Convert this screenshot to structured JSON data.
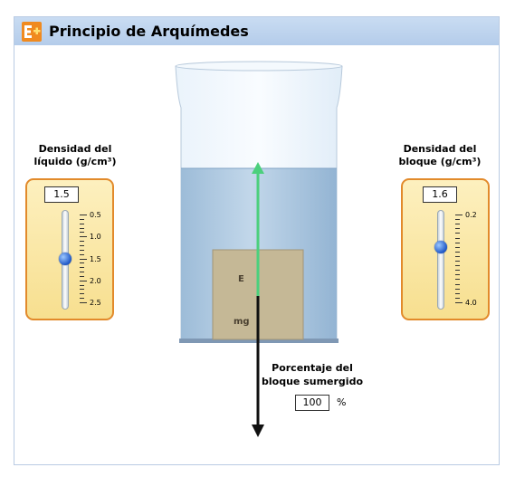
{
  "app": {
    "title": "Principio de Arquímedes",
    "logo": "arrow-plus-logo-icon"
  },
  "liquid_panel": {
    "title_line1": "Densidad del",
    "title_line2": "líquido (g/cm³)",
    "value": "1.5",
    "scale_labels": [
      "0.5",
      "1.0",
      "1.5",
      "2.0",
      "2.5"
    ],
    "min": 0.5,
    "max": 2.5,
    "current": 1.5
  },
  "block_panel": {
    "title_line1": "Densidad del",
    "title_line2": "bloque (g/cm³)",
    "value": "1.6",
    "scale_labels": [
      "0.2",
      "4.0"
    ],
    "min": 0.2,
    "max": 4.0,
    "current": 1.6
  },
  "beaker": {
    "force_buoyancy": "E",
    "force_weight": "mg",
    "colors": {
      "water": "#a7c5e0",
      "block": "#c5b896",
      "buoyancy_arrow": "#4cd07d",
      "weight_arrow": "#000000"
    }
  },
  "percentage": {
    "label_line1": "Porcentaje del",
    "label_line2": "bloque sumergido",
    "value": "100",
    "unit": "%"
  }
}
